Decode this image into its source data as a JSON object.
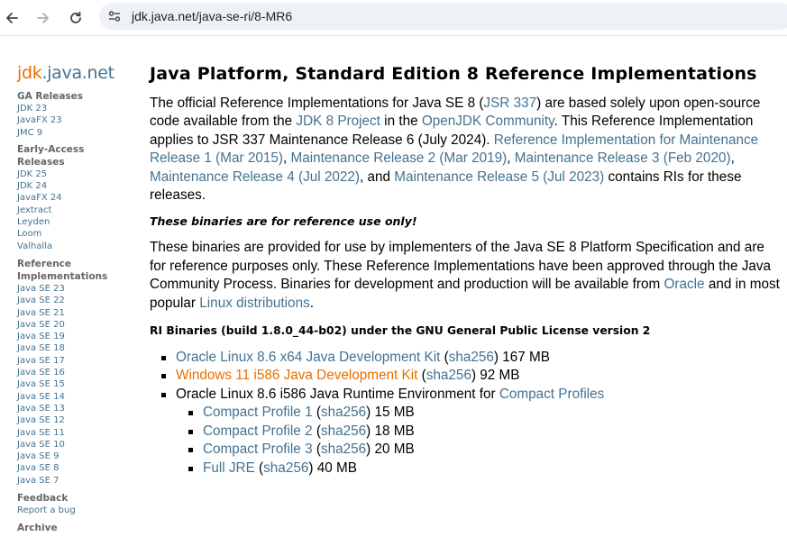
{
  "browser": {
    "url": "jdk.java.net/java-se-ri/8-MR6"
  },
  "sidebar": {
    "logo_jdk": "jdk",
    "logo_rest": ".java.net",
    "groups": [
      {
        "heading": "GA Releases",
        "links": [
          "JDK 23",
          "JavaFX 23",
          "JMC 9"
        ]
      },
      {
        "heading": "Early-Access Releases",
        "links": [
          "JDK 25",
          "JDK 24",
          "JavaFX 24",
          "Jextract",
          "Leyden",
          "Loom",
          "Valhalla"
        ]
      },
      {
        "heading": "Reference Implementations",
        "links": [
          "Java SE 23",
          "Java SE 22",
          "Java SE 21",
          "Java SE 20",
          "Java SE 19",
          "Java SE 18",
          "Java SE 17",
          "Java SE 16",
          "Java SE 15",
          "Java SE 14",
          "Java SE 13",
          "Java SE 12",
          "Java SE 11",
          "Java SE 10",
          "Java SE 9",
          "Java SE 8",
          "Java SE 7"
        ]
      },
      {
        "heading": "Feedback",
        "links": [
          "Report a bug"
        ]
      },
      {
        "heading": "Archive",
        "links": []
      }
    ]
  },
  "main": {
    "title": "Java Platform, Standard Edition 8 Reference Implementations",
    "intro": {
      "t1": "The official Reference Implementations for Java SE 8 (",
      "l_jsr": "JSR 337",
      "t2": ") are based solely upon open-source code available from the ",
      "l_project": "JDK 8 Project",
      "t3": " in the ",
      "l_openjdk": "OpenJDK Community",
      "t4": ". This Reference Implementation applies to JSR 337 Maintenance Release 6 (July 2024). ",
      "l_mr1": "Reference Implementation for Maintenance Release 1 (Mar 2015)",
      "t5": ", ",
      "l_mr2": "Maintenance Release 2 (Mar 2019)",
      "t6": ", ",
      "l_mr3": "Maintenance Release 3 (Feb 2020)",
      "t7": ", ",
      "l_mr4": "Maintenance Release 4 (Jul 2022)",
      "t8": ", and ",
      "l_mr5": "Maintenance Release 5 (Jul 2023)",
      "t9": " contains RIs for these releases."
    },
    "warning": "These binaries are for reference use only!",
    "para2": {
      "t1": "These binaries are provided for use by implementers of the Java SE 8 Platform Specification and are for reference purposes only. These Reference Implementations have been approved through the Java Community Process. Binaries for development and production will be available from ",
      "l_oracle": "Oracle",
      "t2": " and in most popular ",
      "l_linux": "Linux distributions",
      "t3": "."
    },
    "ri_heading": "RI Binaries (build 1.8.0_44-b02) under the GNU General Public License version 2",
    "downloads": [
      {
        "name": "Oracle Linux 8.6 x64 Java Development Kit",
        "open": " (",
        "sha": "sha256",
        "size": ") 167 MB"
      },
      {
        "name": "Windows 11 i586 Java Development Kit",
        "open": " (",
        "sha": "sha256",
        "size": ") 92 MB"
      }
    ],
    "runtime": {
      "text": "Oracle Linux 8.6 i586 Java Runtime Environment for ",
      "link": "Compact Profiles",
      "profiles": [
        {
          "name": "Compact Profile 1",
          "open": " (",
          "sha": "sha256",
          "size": ") 15 MB"
        },
        {
          "name": "Compact Profile 2",
          "open": " (",
          "sha": "sha256",
          "size": ") 18 MB"
        },
        {
          "name": "Compact Profile 3",
          "open": " (",
          "sha": "sha256",
          "size": ") 20 MB"
        },
        {
          "name": "Full JRE",
          "open": " (",
          "sha": "sha256",
          "size": ") 40 MB"
        }
      ]
    }
  },
  "colors": {
    "link": "#437291",
    "visited_link": "#e76f00",
    "sidebar_heading": "#666666",
    "omnibox_bg": "#eef1f8"
  }
}
